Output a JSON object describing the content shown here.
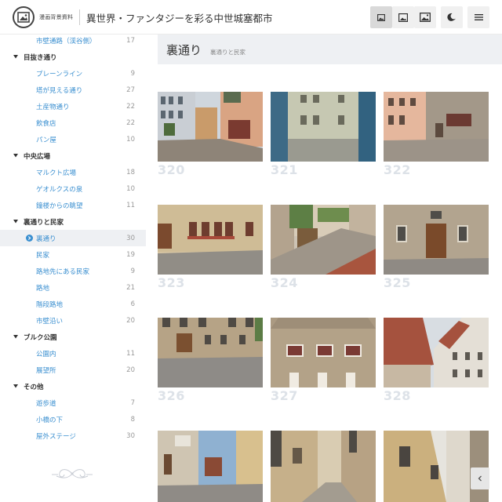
{
  "header": {
    "logo_text": "漫画背景資料",
    "site_title": "異世界・ファンタジーを彩る中世城塞都市",
    "buttons": [
      "image-small-icon",
      "image-medium-icon",
      "image-large-icon",
      "moon-icon",
      "menu-icon"
    ]
  },
  "sidebar": {
    "top_item": {
      "label": "市壁通路（渓谷側）",
      "count": "17"
    },
    "groups": [
      {
        "label": "目抜き通り",
        "items": [
          {
            "label": "プレーンライン",
            "count": "9"
          },
          {
            "label": "塔が見える通り",
            "count": "27"
          },
          {
            "label": "土産物通り",
            "count": "22"
          },
          {
            "label": "飲食店",
            "count": "22"
          },
          {
            "label": "パン屋",
            "count": "10"
          }
        ]
      },
      {
        "label": "中央広場",
        "items": [
          {
            "label": "マルクト広場",
            "count": "18"
          },
          {
            "label": "ゲオルクスの泉",
            "count": "10"
          },
          {
            "label": "鐘楼からの眺望",
            "count": "11"
          }
        ]
      },
      {
        "label": "裏通りと民家",
        "items": [
          {
            "label": "裏通り",
            "count": "30"
          },
          {
            "label": "民家",
            "count": "19"
          },
          {
            "label": "路地先にある民家",
            "count": "9"
          },
          {
            "label": "路地",
            "count": "21"
          },
          {
            "label": "階段路地",
            "count": "6"
          },
          {
            "label": "市壁沿い",
            "count": "20"
          }
        ]
      },
      {
        "label": "ブルク公園",
        "items": [
          {
            "label": "公園内",
            "count": "11"
          },
          {
            "label": "展望所",
            "count": "20"
          }
        ]
      },
      {
        "label": "その他",
        "items": [
          {
            "label": "遊歩道",
            "count": "7"
          },
          {
            "label": "小橋の下",
            "count": "8"
          },
          {
            "label": "屋外ステージ",
            "count": "30"
          }
        ]
      }
    ]
  },
  "main": {
    "title": "裏通り",
    "subtitle": "裏通りと民家",
    "thumbs": [
      "320",
      "321",
      "322",
      "323",
      "324",
      "325",
      "326",
      "327",
      "328",
      "",
      "",
      ""
    ]
  },
  "colors": {
    "accent": "#3a8fd0",
    "number": "#dde2e8",
    "head_bg": "#eef0f3"
  }
}
